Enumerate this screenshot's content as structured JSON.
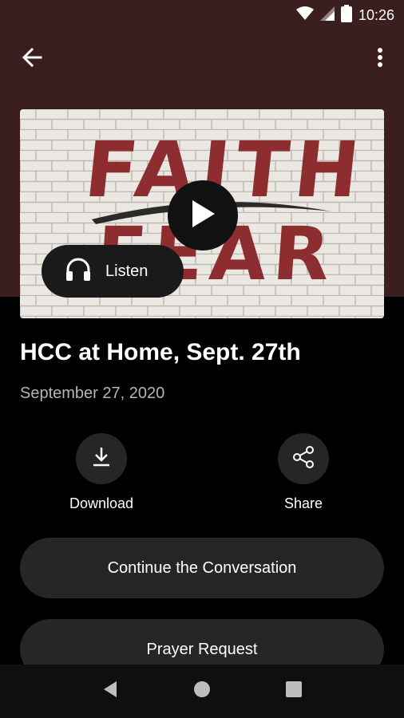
{
  "status_bar": {
    "time": "10:26",
    "icons": [
      "wifi-icon",
      "signal-icon",
      "battery-icon"
    ]
  },
  "toolbar": {
    "back_icon": "arrow-back-icon",
    "more_icon": "more-vert-icon"
  },
  "hero": {
    "artwork_line1": "FAITH",
    "artwork_line2": "FEAR",
    "play_icon": "play-icon",
    "listen_label": "Listen",
    "listen_icon": "headphones-icon"
  },
  "content": {
    "title": "HCC at Home, Sept. 27th",
    "date": "September 27, 2020"
  },
  "actions": [
    {
      "label": "Download",
      "icon": "download-icon"
    },
    {
      "label": "Share",
      "icon": "share-icon"
    }
  ],
  "buttons": {
    "continue": "Continue the Conversation",
    "prayer": "Prayer Request"
  },
  "nav_bar": {
    "icons": [
      "back-triangle-icon",
      "home-circle-icon",
      "recents-square-icon"
    ]
  },
  "colors": {
    "header_bg": "#3b1e1e",
    "surface": "#262626",
    "artwork_red": "#8e2d2f",
    "background": "#000000"
  }
}
